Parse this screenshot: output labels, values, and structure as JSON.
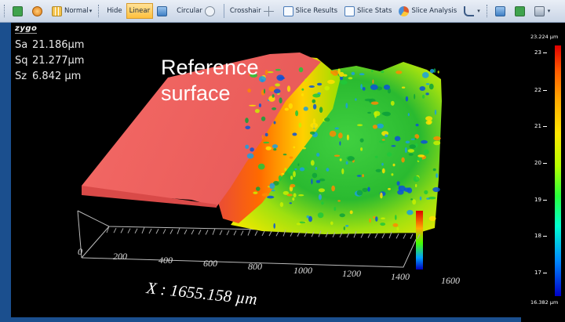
{
  "toolbar": {
    "normal_label": "Normal",
    "hide_label": "Hide",
    "linear_label": "Linear",
    "circular_label": "Circular",
    "crosshair_label": "Crosshair",
    "slice_results_label": "Slice Results",
    "slice_stats_label": "Slice Stats",
    "slice_analysis_label": "Slice Analysis"
  },
  "logo": "zygo",
  "stats": {
    "sa": {
      "key": "Sa",
      "value": "21.186µm"
    },
    "sq": {
      "key": "Sq",
      "value": "21.277µm"
    },
    "sz": {
      "key": "Sz",
      "value": "6.842  µm"
    }
  },
  "annotation": {
    "line1": "Reference",
    "line2": "surface"
  },
  "axis": {
    "x_ticks": [
      "0",
      "200",
      "400",
      "600",
      "800",
      "1000",
      "1200",
      "1400",
      "1600"
    ],
    "x_label": "X : 1655.158 µm"
  },
  "colorbar": {
    "max": "23.224 µm",
    "min": "16.382 µm",
    "ticks": [
      "23",
      "22",
      "21",
      "20",
      "19",
      "18",
      "17"
    ]
  },
  "colors": {
    "reference": "#f06060",
    "accent": "#ffc03c",
    "frame": "#1b4f8e"
  }
}
